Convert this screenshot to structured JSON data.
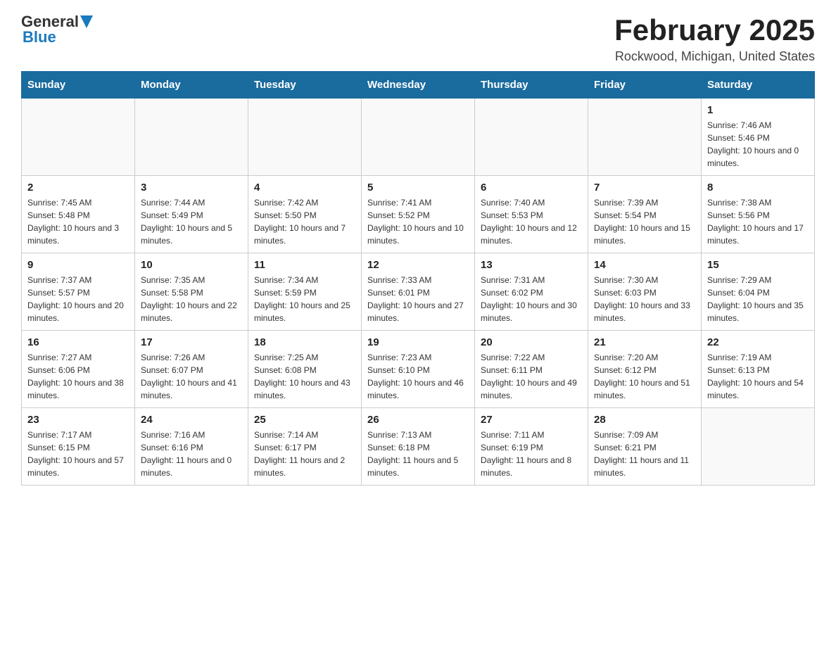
{
  "header": {
    "logo_general": "General",
    "logo_blue": "Blue",
    "title": "February 2025",
    "subtitle": "Rockwood, Michigan, United States"
  },
  "days_of_week": [
    "Sunday",
    "Monday",
    "Tuesday",
    "Wednesday",
    "Thursday",
    "Friday",
    "Saturday"
  ],
  "weeks": [
    {
      "days": [
        {
          "date": "",
          "info": ""
        },
        {
          "date": "",
          "info": ""
        },
        {
          "date": "",
          "info": ""
        },
        {
          "date": "",
          "info": ""
        },
        {
          "date": "",
          "info": ""
        },
        {
          "date": "",
          "info": ""
        },
        {
          "date": "1",
          "info": "Sunrise: 7:46 AM\nSunset: 5:46 PM\nDaylight: 10 hours and 0 minutes."
        }
      ]
    },
    {
      "days": [
        {
          "date": "2",
          "info": "Sunrise: 7:45 AM\nSunset: 5:48 PM\nDaylight: 10 hours and 3 minutes."
        },
        {
          "date": "3",
          "info": "Sunrise: 7:44 AM\nSunset: 5:49 PM\nDaylight: 10 hours and 5 minutes."
        },
        {
          "date": "4",
          "info": "Sunrise: 7:42 AM\nSunset: 5:50 PM\nDaylight: 10 hours and 7 minutes."
        },
        {
          "date": "5",
          "info": "Sunrise: 7:41 AM\nSunset: 5:52 PM\nDaylight: 10 hours and 10 minutes."
        },
        {
          "date": "6",
          "info": "Sunrise: 7:40 AM\nSunset: 5:53 PM\nDaylight: 10 hours and 12 minutes."
        },
        {
          "date": "7",
          "info": "Sunrise: 7:39 AM\nSunset: 5:54 PM\nDaylight: 10 hours and 15 minutes."
        },
        {
          "date": "8",
          "info": "Sunrise: 7:38 AM\nSunset: 5:56 PM\nDaylight: 10 hours and 17 minutes."
        }
      ]
    },
    {
      "days": [
        {
          "date": "9",
          "info": "Sunrise: 7:37 AM\nSunset: 5:57 PM\nDaylight: 10 hours and 20 minutes."
        },
        {
          "date": "10",
          "info": "Sunrise: 7:35 AM\nSunset: 5:58 PM\nDaylight: 10 hours and 22 minutes."
        },
        {
          "date": "11",
          "info": "Sunrise: 7:34 AM\nSunset: 5:59 PM\nDaylight: 10 hours and 25 minutes."
        },
        {
          "date": "12",
          "info": "Sunrise: 7:33 AM\nSunset: 6:01 PM\nDaylight: 10 hours and 27 minutes."
        },
        {
          "date": "13",
          "info": "Sunrise: 7:31 AM\nSunset: 6:02 PM\nDaylight: 10 hours and 30 minutes."
        },
        {
          "date": "14",
          "info": "Sunrise: 7:30 AM\nSunset: 6:03 PM\nDaylight: 10 hours and 33 minutes."
        },
        {
          "date": "15",
          "info": "Sunrise: 7:29 AM\nSunset: 6:04 PM\nDaylight: 10 hours and 35 minutes."
        }
      ]
    },
    {
      "days": [
        {
          "date": "16",
          "info": "Sunrise: 7:27 AM\nSunset: 6:06 PM\nDaylight: 10 hours and 38 minutes."
        },
        {
          "date": "17",
          "info": "Sunrise: 7:26 AM\nSunset: 6:07 PM\nDaylight: 10 hours and 41 minutes."
        },
        {
          "date": "18",
          "info": "Sunrise: 7:25 AM\nSunset: 6:08 PM\nDaylight: 10 hours and 43 minutes."
        },
        {
          "date": "19",
          "info": "Sunrise: 7:23 AM\nSunset: 6:10 PM\nDaylight: 10 hours and 46 minutes."
        },
        {
          "date": "20",
          "info": "Sunrise: 7:22 AM\nSunset: 6:11 PM\nDaylight: 10 hours and 49 minutes."
        },
        {
          "date": "21",
          "info": "Sunrise: 7:20 AM\nSunset: 6:12 PM\nDaylight: 10 hours and 51 minutes."
        },
        {
          "date": "22",
          "info": "Sunrise: 7:19 AM\nSunset: 6:13 PM\nDaylight: 10 hours and 54 minutes."
        }
      ]
    },
    {
      "days": [
        {
          "date": "23",
          "info": "Sunrise: 7:17 AM\nSunset: 6:15 PM\nDaylight: 10 hours and 57 minutes."
        },
        {
          "date": "24",
          "info": "Sunrise: 7:16 AM\nSunset: 6:16 PM\nDaylight: 11 hours and 0 minutes."
        },
        {
          "date": "25",
          "info": "Sunrise: 7:14 AM\nSunset: 6:17 PM\nDaylight: 11 hours and 2 minutes."
        },
        {
          "date": "26",
          "info": "Sunrise: 7:13 AM\nSunset: 6:18 PM\nDaylight: 11 hours and 5 minutes."
        },
        {
          "date": "27",
          "info": "Sunrise: 7:11 AM\nSunset: 6:19 PM\nDaylight: 11 hours and 8 minutes."
        },
        {
          "date": "28",
          "info": "Sunrise: 7:09 AM\nSunset: 6:21 PM\nDaylight: 11 hours and 11 minutes."
        },
        {
          "date": "",
          "info": ""
        }
      ]
    }
  ]
}
